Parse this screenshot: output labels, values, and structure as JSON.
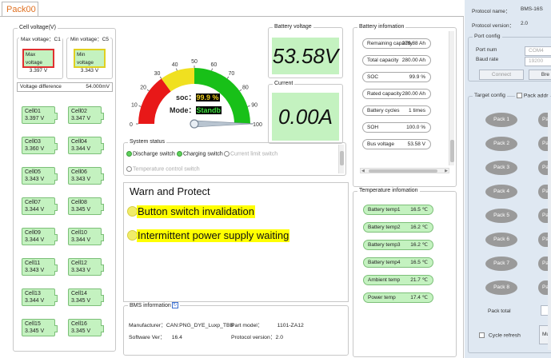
{
  "tab": {
    "label": "Pack00"
  },
  "cell_voltage": {
    "title": "Cell voltage(V)",
    "max_label": "Max voltage：C1",
    "min_label": "Min voltage：C5",
    "max_box_title": "Max voltage",
    "max_box_value": "3.397 V",
    "min_box_title": "Min voltage",
    "min_box_value": "3.343 V",
    "diff_label": "Voltage difference",
    "diff_value": "54.000mV",
    "cells": [
      {
        "name": "Cell01",
        "value": "3.397 V"
      },
      {
        "name": "Cell02",
        "value": "3.347 V"
      },
      {
        "name": "Cell03",
        "value": "3.360 V"
      },
      {
        "name": "Cell04",
        "value": "3.344 V"
      },
      {
        "name": "Cell05",
        "value": "3.343 V"
      },
      {
        "name": "Cell06",
        "value": "3.343 V"
      },
      {
        "name": "Cell07",
        "value": "3.344 V"
      },
      {
        "name": "Cell08",
        "value": "3.345 V"
      },
      {
        "name": "Cell09",
        "value": "3.344 V"
      },
      {
        "name": "Cell10",
        "value": "3.344 V"
      },
      {
        "name": "Cell11",
        "value": "3.343 V"
      },
      {
        "name": "Cell12",
        "value": "3.343 V"
      },
      {
        "name": "Cell13",
        "value": "3.344 V"
      },
      {
        "name": "Cell14",
        "value": "3.345 V"
      },
      {
        "name": "Cell15",
        "value": "3.345 V"
      },
      {
        "name": "Cell16",
        "value": "3.345 V"
      }
    ]
  },
  "gauge": {
    "ticks": [
      "0",
      "10",
      "20",
      "30",
      "40",
      "50",
      "60",
      "70",
      "80",
      "90",
      "100"
    ],
    "soc_label": "soc：",
    "soc_value": "99.9 %",
    "soc_percent": 99.9,
    "mode_label": "Mode：",
    "mode_value": "Standb",
    "colors": {
      "red": "#e81818",
      "yellow": "#f0e020",
      "green": "#18c018"
    }
  },
  "battery_voltage": {
    "title": "Battery voltage",
    "value": "53.58V"
  },
  "current": {
    "title": "Current",
    "value": "0.00A"
  },
  "system_status": {
    "title": "System status",
    "items": [
      {
        "label": "Discharge switch",
        "on": true
      },
      {
        "label": "Charging switch",
        "on": true
      },
      {
        "label": "Current limit switch",
        "on": false
      },
      {
        "label": "Temperature control switch",
        "on": false
      }
    ]
  },
  "warn": {
    "title": "Warn and Protect",
    "items": [
      "Button switch invalidation",
      "Intermittent power supply waiting"
    ]
  },
  "bms_info": {
    "title": "BMS information",
    "manufacturer_label": "Manufacturer：",
    "manufacturer_value": "CAN:PNG_DYE_Luxp_TBB",
    "part_label": "Part model：",
    "part_value": "1101-ZA12",
    "software_label": "Software Ver：",
    "software_value": "16.4",
    "protocol_label": "Protocol version：",
    "protocol_value": "2.0"
  },
  "battery_info": {
    "title": "Battery infomation",
    "rows": [
      {
        "label": "Remaining capacity",
        "value": "279.88 Ah"
      },
      {
        "label": "Total capacity",
        "value": "280.00 Ah"
      },
      {
        "label": "SOC",
        "value": "99.9 %"
      },
      {
        "label": "Rated capacity",
        "value": "280.00 Ah"
      },
      {
        "label": "Battery cycles",
        "value": "1 times"
      },
      {
        "label": "SOH",
        "value": "100.0 %"
      },
      {
        "label": "Bus voltage",
        "value": "53.58 V"
      }
    ]
  },
  "temperature": {
    "title": "Temperature infomation",
    "rows": [
      {
        "label": "Battery temp1",
        "value": "16.5 ℃"
      },
      {
        "label": "Battery temp2",
        "value": "16.2 ℃"
      },
      {
        "label": "Battery temp3",
        "value": "16.2 ℃"
      },
      {
        "label": "Battery temp4",
        "value": "16.5 ℃"
      },
      {
        "label": "Ambient temp",
        "value": "21.7 ℃"
      },
      {
        "label": "Power temp",
        "value": "17.4 ℃"
      }
    ]
  },
  "right_panel": {
    "protocol_name_label": "Protocol name：",
    "protocol_name_value": "BMS-16S",
    "protocol_version_label": "Protocol version：",
    "protocol_version_value": "2.0",
    "port_config_title": "Port config",
    "port_num_label": "Port num",
    "port_num_value": "COM4",
    "baud_label": "Baud rate",
    "baud_value": "19200",
    "connect_label": "Connect",
    "break_label": "Bre",
    "target_config_title": "Target config",
    "pack_addr_label": "Pack addr",
    "packs_left": [
      "Pack 1",
      "Pack 2",
      "Pack 3",
      "Pack 4",
      "Pack 5",
      "Pack 6",
      "Pack 7",
      "Pack 8"
    ],
    "packs_right": [
      "Pack",
      "Pack",
      "Pack",
      "Pack",
      "Pack",
      "Pack",
      "Pack",
      "Pack"
    ],
    "pack_total_label": "Pack total",
    "cycle_refresh_label": "Cycle refresh",
    "mu_label": "Mu"
  }
}
